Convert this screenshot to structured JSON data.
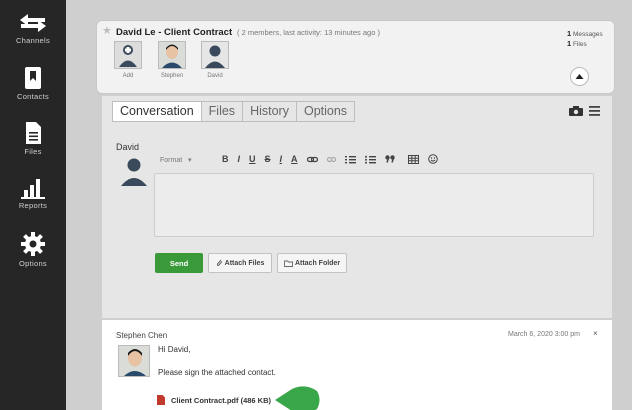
{
  "sidebar": {
    "items": [
      {
        "label": "Channels",
        "icon": "channels-arrows-icon"
      },
      {
        "label": "Contacts",
        "icon": "contacts-book-icon"
      },
      {
        "label": "Files",
        "icon": "file-icon"
      },
      {
        "label": "Reports",
        "icon": "bar-chart-icon"
      },
      {
        "label": "Options",
        "icon": "gear-icon"
      }
    ]
  },
  "channel": {
    "title": "David Le - Client Contract",
    "meta": "( 2 members, last activity: 13 minutes ago )",
    "members": [
      {
        "name": "Add"
      },
      {
        "name": "Stephen"
      },
      {
        "name": "David"
      }
    ],
    "stats": {
      "messages_count": "1",
      "messages_label": "Messages",
      "files_count": "1",
      "files_label": "Files"
    }
  },
  "tabs": [
    {
      "label": "Conversation",
      "active": true
    },
    {
      "label": "Files"
    },
    {
      "label": "History"
    },
    {
      "label": "Options"
    }
  ],
  "compose": {
    "author": "David",
    "format_label": "Format",
    "format_buttons": [
      "B",
      "I",
      "U",
      "S",
      "I",
      "A"
    ],
    "send_label": "Send",
    "attach_files_label": "Attach Files",
    "attach_folder_label": "Attach Folder"
  },
  "message": {
    "author": "Stephen Chen",
    "date": "March 6, 2020 3:00 pm",
    "close": "×",
    "greeting": "Hi David,",
    "body": "Please sign the attached contact.",
    "attachment": "Client Contract.pdf (486 KB)"
  },
  "colors": {
    "send": "#3a9a3a",
    "pointer": "#3aa64a",
    "pdf": "#c0392b"
  }
}
